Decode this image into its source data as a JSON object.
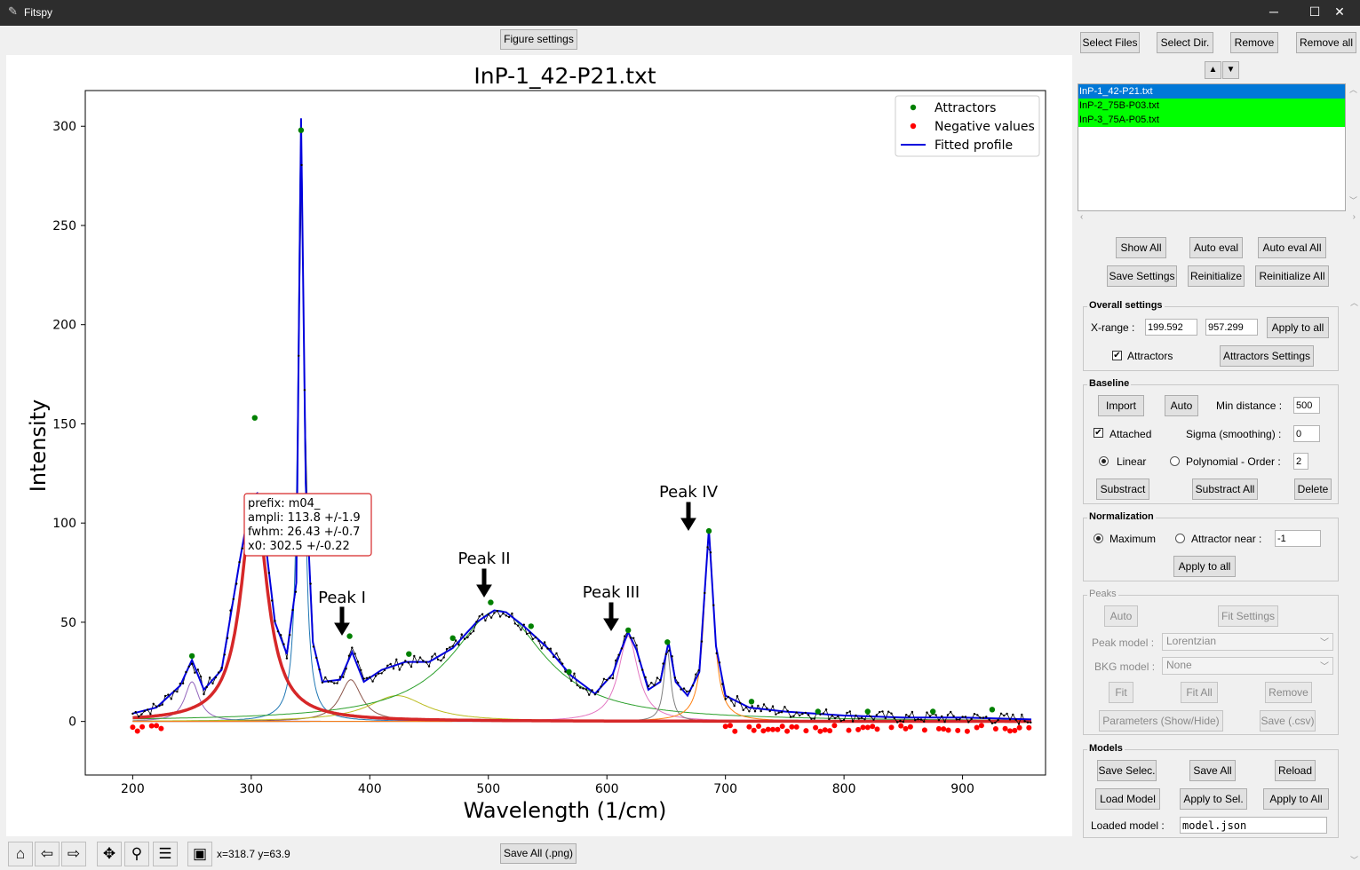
{
  "window": {
    "title": "Fitspy",
    "minimize": "─",
    "maximize": "☐",
    "close": "✕"
  },
  "figure_settings": "Figure settings",
  "save_all_png": "Save All (.png)",
  "coord_readout": "x=318.7 y=63.9",
  "plot": {
    "title": "InP-1_42-P21.txt",
    "xlabel": "Wavelength (1/cm)",
    "ylabel": "Intensity",
    "xticks": [
      "200",
      "300",
      "400",
      "500",
      "600",
      "700",
      "800",
      "900"
    ],
    "yticks": [
      "0",
      "50",
      "100",
      "150",
      "200",
      "250",
      "300"
    ],
    "legend": {
      "attractors": "Attractors",
      "negative": "Negative values",
      "fitted": "Fitted profile"
    },
    "tooltip": {
      "l1": "prefix: m04_",
      "l2": "ampli: 113.8 +/-1.9",
      "l3": "fwhm: 26.43 +/-0.7",
      "l4": "x0: 302.5 +/-0.22"
    },
    "annotations": {
      "p1": "Peak I",
      "p2": "Peak II",
      "p3": "Peak III",
      "p4": "Peak IV"
    },
    "colors": {
      "fitted": "#0000dd",
      "attractor": "#008000",
      "negative": "#ff0000",
      "selected_peak": "#d62728"
    }
  },
  "chart_data": {
    "type": "line",
    "title": "InP-1_42-P21.txt",
    "xlabel": "Wavelength (1/cm)",
    "ylabel": "Intensity",
    "xlim": [
      160,
      970
    ],
    "ylim": [
      -27,
      318
    ],
    "legend_position": "top-right",
    "series": [
      {
        "name": "Fitted profile",
        "x": [
          200,
          220,
          240,
          250,
          260,
          275,
          290,
          300,
          305,
          312,
          320,
          330,
          338,
          342,
          346,
          352,
          360,
          375,
          385,
          395,
          410,
          430,
          450,
          470,
          490,
          505,
          515,
          530,
          550,
          570,
          590,
          605,
          612,
          618,
          625,
          635,
          645,
          652,
          658,
          668,
          678,
          686,
          692,
          700,
          720,
          750,
          800,
          850,
          900,
          958
        ],
        "y": [
          4,
          7,
          18,
          31,
          16,
          26,
          80,
          113,
          115,
          90,
          50,
          34,
          70,
          304,
          120,
          40,
          20,
          21,
          35,
          20,
          26,
          30,
          30,
          37,
          50,
          56,
          55,
          48,
          37,
          23,
          14,
          24,
          36,
          45,
          36,
          16,
          20,
          40,
          20,
          13,
          25,
          97,
          38,
          13,
          7,
          5,
          3,
          2,
          2,
          1
        ]
      },
      {
        "name": "Attractors",
        "x": [
          250,
          303,
          342,
          383,
          433,
          470,
          502,
          536,
          568,
          618,
          651,
          686,
          722,
          778,
          820,
          875,
          925
        ],
        "y": [
          33,
          153,
          298,
          43,
          34,
          42,
          60,
          48,
          25,
          46,
          40,
          96,
          10,
          5,
          5,
          5,
          6
        ]
      }
    ],
    "selected_peak": {
      "prefix": "m04_",
      "ampli": 113.8,
      "fwhm": 26.43,
      "x0": 302.5
    }
  },
  "files": {
    "select_files": "Select Files",
    "select_dir": "Select Dir.",
    "remove": "Remove",
    "remove_all": "Remove all",
    "up": "▲",
    "down": "▼",
    "items": [
      "InP-1_42-P21.txt",
      "InP-2_75B-P03.txt",
      "InP-3_75A-P05.txt"
    ]
  },
  "actions": {
    "show_all": "Show All",
    "auto_eval": "Auto eval",
    "auto_eval_all": "Auto eval All",
    "save_settings": "Save Settings",
    "reinitialize": "Reinitialize",
    "reinitialize_all": "Reinitialize All"
  },
  "overall": {
    "title": "Overall settings",
    "xrange_label": "X-range :",
    "xmin": "199.592",
    "xmax": "957.299",
    "apply_to_all": "Apply to all",
    "attractors": "Attractors",
    "attractors_settings": "Attractors Settings"
  },
  "baseline": {
    "title": "Baseline",
    "import": "Import",
    "auto": "Auto",
    "min_distance_label": "Min distance :",
    "min_distance": "500",
    "attached": "Attached",
    "sigma_label": "Sigma (smoothing) :",
    "sigma": "0",
    "linear": "Linear",
    "polynomial": "Polynomial - Order :",
    "order": "2",
    "substract": "Substract",
    "substract_all": "Substract All",
    "delete": "Delete"
  },
  "normalization": {
    "title": "Normalization",
    "maximum": "Maximum",
    "attractor_near": "Attractor near :",
    "attractor_value": "-1",
    "apply_to_all": "Apply to all"
  },
  "peaks": {
    "title": "Peaks",
    "auto": "Auto",
    "fit_settings": "Fit Settings",
    "peak_model_label": "Peak model :",
    "peak_model": "Lorentzian",
    "bkg_model_label": "BKG model :",
    "bkg_model": "None",
    "fit": "Fit",
    "fit_all": "Fit All",
    "remove": "Remove",
    "parameters": "Parameters (Show/Hide)",
    "save_csv": "Save (.csv)"
  },
  "models": {
    "title": "Models",
    "save_selec": "Save Selec.",
    "save_all": "Save All",
    "reload": "Reload",
    "load_model": "Load Model",
    "apply_to_sel": "Apply to Sel.",
    "apply_to_all": "Apply to All",
    "loaded_label": "Loaded model :",
    "loaded": "model.json"
  }
}
